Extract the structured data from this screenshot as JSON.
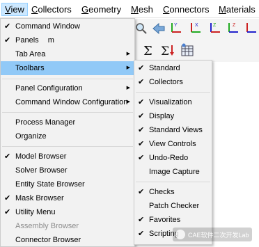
{
  "menubar": {
    "items": [
      {
        "label": "View",
        "underline": "V",
        "rest": "iew"
      },
      {
        "label": "Collectors",
        "underline": "C",
        "rest": "ollectors"
      },
      {
        "label": "Geometry",
        "underline": "G",
        "rest": "eometry"
      },
      {
        "label": "Mesh",
        "underline": "M",
        "rest": "esh"
      },
      {
        "label": "Connectors",
        "underline": "C",
        "rest": "onnectors"
      },
      {
        "label": "Materials",
        "underline": "M",
        "rest": "aterials"
      }
    ]
  },
  "view_menu": {
    "items": [
      {
        "label": "Command Window",
        "checked": true
      },
      {
        "label": "Panels",
        "suffix": "m",
        "checked": true
      },
      {
        "label": "Tab Area",
        "submenu": true
      },
      {
        "label": "Toolbars",
        "submenu": true,
        "highlighted": true
      },
      {
        "label": "Panel Configuration",
        "submenu": true
      },
      {
        "label": "Command Window Configuration",
        "submenu": true
      },
      {
        "label": "Process Manager"
      },
      {
        "label": "Organize"
      },
      {
        "label": "Model Browser",
        "checked": true
      },
      {
        "label": "Solver Browser"
      },
      {
        "label": "Entity State Browser"
      },
      {
        "label": "Mask Browser",
        "checked": true
      },
      {
        "label": "Utility Menu",
        "checked": true
      },
      {
        "label": "Assembly Browser",
        "disabled": true
      },
      {
        "label": "Connector Browser"
      }
    ]
  },
  "toolbars_menu": {
    "items": [
      {
        "label": "Standard",
        "checked": true
      },
      {
        "label": "Collectors",
        "checked": true
      },
      {
        "label": "Visualization",
        "checked": true
      },
      {
        "label": "Display",
        "checked": true
      },
      {
        "label": "Standard Views",
        "checked": true
      },
      {
        "label": "View Controls",
        "checked": true
      },
      {
        "label": "Undo-Redo",
        "checked": true
      },
      {
        "label": "Image Capture"
      },
      {
        "label": "Checks",
        "checked": true
      },
      {
        "label": "Patch Checker"
      },
      {
        "label": "Favorites",
        "checked": true
      },
      {
        "label": "Scripting",
        "checked": true
      }
    ]
  },
  "watermark": {
    "text": "CAE软件二次开发Lab"
  },
  "colors": {
    "highlight": "#91c9f7",
    "menu_bg": "#f2f2f2",
    "active_menubar": "#cce8ff"
  }
}
